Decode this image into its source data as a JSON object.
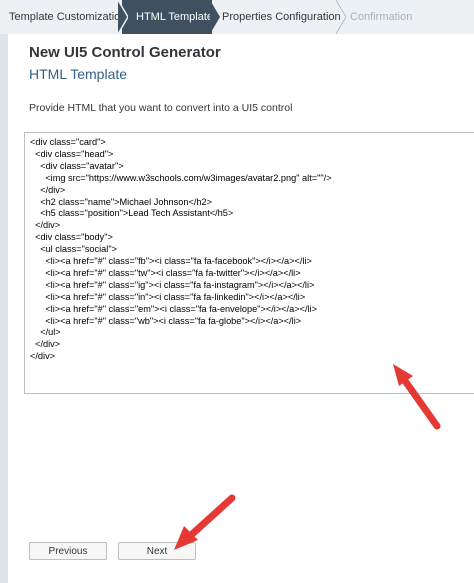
{
  "wizard": {
    "steps": [
      {
        "label": "Template Customization",
        "state": "completed"
      },
      {
        "label": "HTML Template",
        "state": "current"
      },
      {
        "label": "Properties Configuration",
        "state": "upcoming"
      },
      {
        "label": "Confirmation",
        "state": "disabled"
      }
    ]
  },
  "page": {
    "title": "New UI5 Control Generator",
    "subtitle": "HTML Template",
    "instructions": "Provide HTML that you want to convert into a UI5 control"
  },
  "editor": {
    "lines": [
      "<div class=\"card\">",
      "  <div class=\"head\">",
      "    <div class=\"avatar\">",
      "      <img src=\"https://www.w3schools.com/w3images/avatar2.png\" alt=\"\"/>",
      "    </div>",
      "    <h2 class=\"name\">Michael Johnson</h2>",
      "    <h5 class=\"position\">Lead Tech Assistant</h5>",
      "  </div>",
      "  <div class=\"body\">",
      "    <ul class=\"social\">",
      "      <li><a href=\"#\" class=\"fb\"><i class=\"fa fa-facebook\"></i></a></li>",
      "      <li><a href=\"#\" class=\"tw\"><i class=\"fa fa-twitter\"></i></a></li>",
      "      <li><a href=\"#\" class=\"ig\"><i class=\"fa fa-instagram\"></i></a></li>",
      "      <li><a href=\"#\" class=\"in\"><i class=\"fa fa-linkedin\"></i></a></li>",
      "      <li><a href=\"#\" class=\"em\"><i class=\"fa fa-envelope\"></i></a></li>",
      "      <li><a href=\"#\" class=\"wb\"><i class=\"fa fa-globe\"></i></a></li>",
      "    </ul>",
      "  </div>",
      "</div>"
    ]
  },
  "footer": {
    "previous_label": "Previous",
    "next_label": "Next"
  },
  "colors": {
    "current_step": "#3f5161",
    "subtitle": "#346187",
    "annotation_arrow": "#e53935"
  }
}
